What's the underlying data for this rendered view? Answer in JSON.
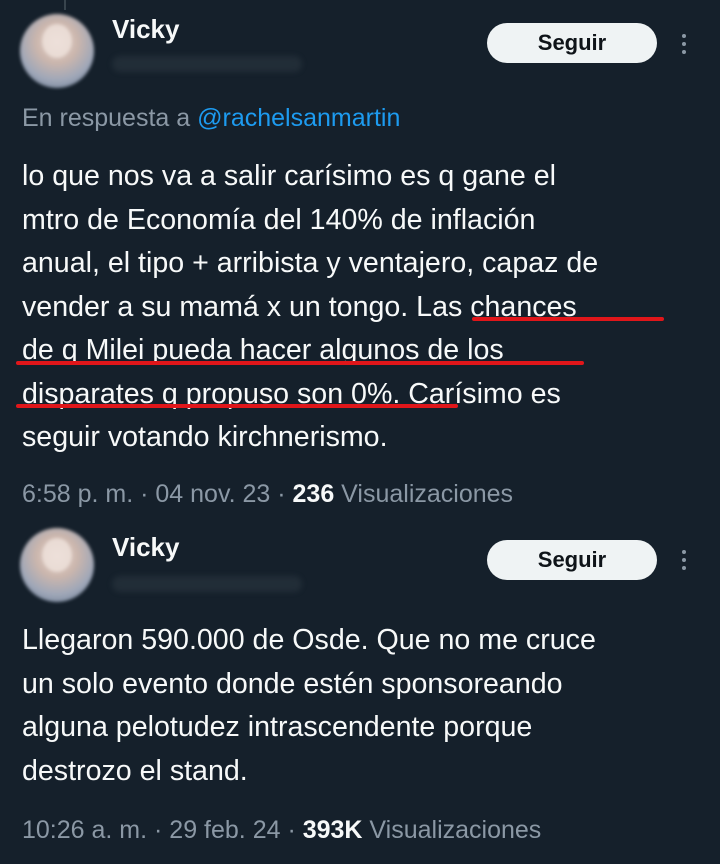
{
  "thread": [
    {
      "author_name": "Vicky",
      "follow_label": "Seguir",
      "reply_prefix": "En respuesta a ",
      "reply_mention": "@rachelsanmartin",
      "lines": [
        "lo que nos va a salir carísimo es q gane el",
        "mtro de Economía del 140% de inflación",
        "anual, el tipo + arribista y ventajero, capaz de",
        "vender a su mamá x un tongo. Las chances",
        "de q Milei pueda hacer algunos de los",
        "disparates q propuso son 0%. Carísimo es",
        "seguir votando kirchnerismo."
      ],
      "time": "6:58 p. m. · 04 nov. 23 · ",
      "views_count": "236",
      "views_label": " Visualizaciones"
    },
    {
      "author_name": "Vicky",
      "follow_label": "Seguir",
      "lines": [
        "Llegaron 590.000 de Osde. Que no me cruce",
        "un solo evento donde estén sponsoreando",
        "alguna pelotudez intrascendente porque",
        "destrozo el stand."
      ],
      "time": "10:26 a. m. · 29 feb. 24 · ",
      "views_count": "393K",
      "views_label": " Visualizaciones"
    }
  ],
  "icons": {
    "more": "more-horizontal-icon"
  },
  "colors": {
    "background": "#15202b",
    "text": "#f7f9f9",
    "muted": "#8b98a5",
    "link": "#1d9bf0",
    "highlight_underline": "#e0161a",
    "button_bg": "#eff3f4"
  }
}
